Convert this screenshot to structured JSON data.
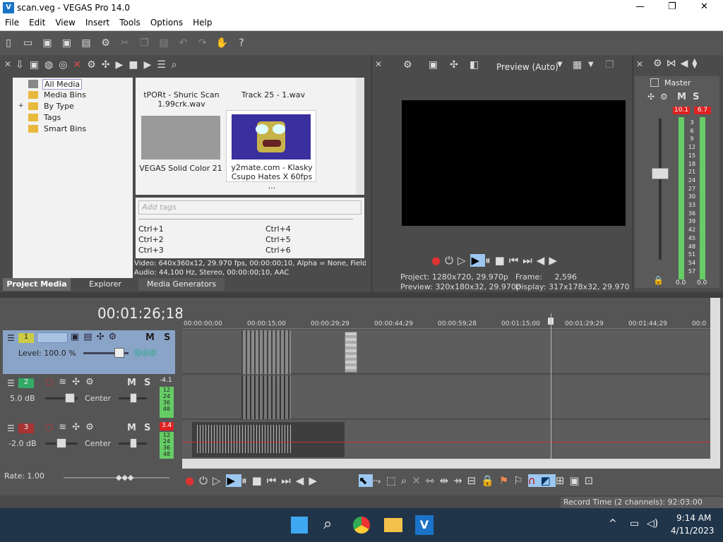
{
  "window": {
    "title": "scan.veg - VEGAS Pro 14.0",
    "min": "—",
    "max": "❐",
    "close": "✕"
  },
  "menu": [
    "File",
    "Edit",
    "View",
    "Insert",
    "Tools",
    "Options",
    "Help"
  ],
  "project_media": {
    "tree": [
      "All Media",
      "Media Bins",
      "By Type",
      "Tags",
      "Smart Bins"
    ],
    "items": [
      {
        "label": "tPORt - Shuric Scan 1.99crk.wav"
      },
      {
        "label": "Track 25 - 1.wav"
      },
      {
        "label": "VEGAS Solid Color 21"
      },
      {
        "label": "y2mate.com - Klasky Csupo Hates X 60fps ..."
      }
    ],
    "tags_placeholder": "Add tags",
    "shortcuts": [
      "Ctrl+1",
      "Ctrl+4",
      "Ctrl+2",
      "Ctrl+5",
      "Ctrl+3",
      "Ctrl+6"
    ],
    "info_video": "Video: 640x360x12, 29.970 fps, 00:00:00;10, Alpha = None, Field O",
    "info_audio": "Audio: 44,100 Hz, Stereo, 00:00:00;10, AAC",
    "tabs": [
      "Project Media",
      "Explorer",
      "Media Generators"
    ]
  },
  "preview": {
    "mode": "Preview (Auto)",
    "project_label": "Project:",
    "project_val": "1280x720, 29.970p",
    "preview_label": "Preview:",
    "preview_val": "320x180x32, 29.970p",
    "frame_label": "Frame:",
    "frame_val": "2,596",
    "display_label": "Display:",
    "display_val": "317x178x32, 29.970"
  },
  "master": {
    "label": "Master",
    "left_peak": "10.1",
    "right_peak": "6.7",
    "ticks": [
      "3",
      "6",
      "9",
      "12",
      "15",
      "18",
      "21",
      "24",
      "27",
      "30",
      "33",
      "36",
      "39",
      "42",
      "45",
      "48",
      "51",
      "54",
      "57"
    ],
    "left_zero": "0.0",
    "right_zero": "0.0",
    "m": "M",
    "s": "S"
  },
  "timeline": {
    "timecode": "00:01:26;18",
    "ruler": [
      "00:00:00;00",
      "00:00:15;00",
      "00:00:29;29",
      "00:00:44;29",
      "00:00:59;28",
      "00:01:15;00",
      "00:01:29;29",
      "00:01:44;29",
      "00:0"
    ],
    "tracks": [
      {
        "num": "1",
        "level": "Level: 100.0 %",
        "m": "M",
        "s": "S"
      },
      {
        "num": "2",
        "vol": "5.0 dB",
        "pan": "Center",
        "m": "M",
        "s": "S",
        "peak": "-4.1",
        "meter": [
          "12",
          "24",
          "36",
          "48"
        ]
      },
      {
        "num": "3",
        "vol": "-2.0 dB",
        "pan": "Center",
        "m": "M",
        "s": "S",
        "peak": "3.4",
        "meter": [
          "12",
          "24",
          "36",
          "48"
        ]
      }
    ],
    "rate": "Rate: 1.00",
    "record_time": "Record Time (2 channels): 92:03:00"
  },
  "taskbar": {
    "time": "9:14 AM",
    "date": "4/11/2023"
  }
}
